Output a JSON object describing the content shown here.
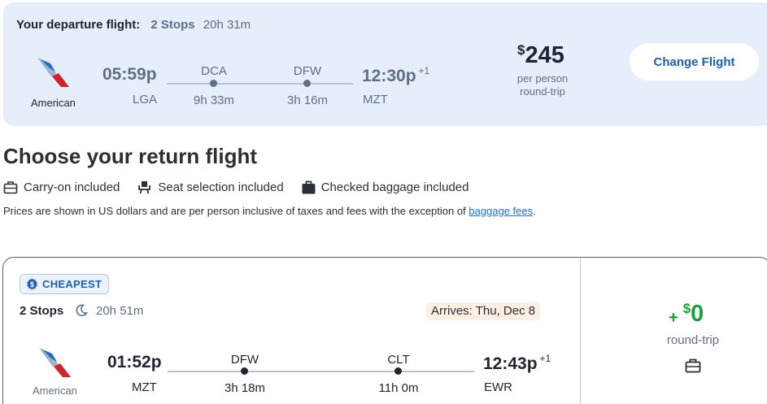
{
  "departure": {
    "label": "Your departure flight:",
    "stops": "2 Stops",
    "duration": "20h 31m",
    "airline": "American",
    "depart_time": "05:59p",
    "depart_code": "LGA",
    "stops_list": [
      {
        "code": "DCA",
        "layover": "9h 33m"
      },
      {
        "code": "DFW",
        "layover": "3h 16m"
      }
    ],
    "arrive_time": "12:30p",
    "arrive_day_offset": "+1",
    "arrive_code": "MZT",
    "price_currency": "$",
    "price_amount": "245",
    "price_note_1": "per person",
    "price_note_2": "round-trip",
    "change_button": "Change Flight"
  },
  "return_section": {
    "title": "Choose your return flight",
    "amenities": [
      {
        "icon": "carry-on-icon",
        "label": "Carry-on included"
      },
      {
        "icon": "seat-icon",
        "label": "Seat selection included"
      },
      {
        "icon": "checked-bag-icon",
        "label": "Checked baggage included"
      }
    ],
    "disclaimer": "Prices are shown in US dollars and are per person inclusive of taxes and fees with the exception of ",
    "disclaimer_link": "baggage fees",
    "disclaimer_end": "."
  },
  "result": {
    "badge": "CHEAPEST",
    "stops": "2 Stops",
    "duration": "20h 51m",
    "arrives": "Arrives: Thu, Dec 8",
    "airline": "American",
    "depart_time": "01:52p",
    "depart_code": "MZT",
    "stops_list": [
      {
        "code": "DFW",
        "layover": "3h 18m"
      },
      {
        "code": "CLT",
        "layover": "11h 0m"
      }
    ],
    "arrive_time": "12:43p",
    "arrive_day_offset": "+1",
    "arrive_code": "EWR",
    "delta_sign": "+",
    "delta_currency": "$",
    "delta_amount": "0",
    "delta_note": "round-trip"
  },
  "colors": {
    "brand_blue": "#1d5fb8",
    "price_green": "#1aa33a",
    "summary_bg": "#e6eefb",
    "arrives_bg": "#fbefe3"
  }
}
